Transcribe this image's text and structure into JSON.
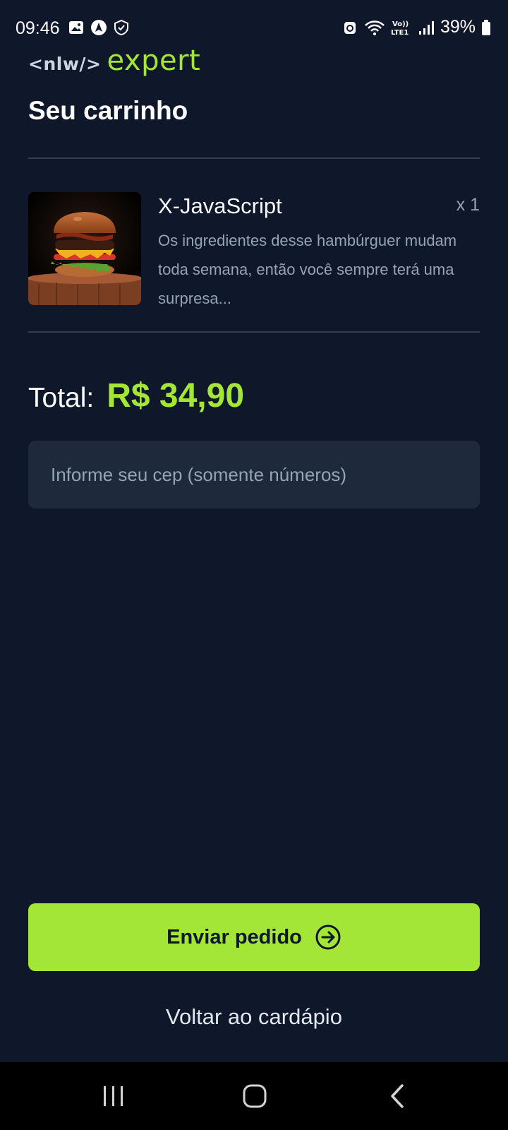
{
  "status_bar": {
    "time": "09:46",
    "battery": "39%",
    "network": "LTE1",
    "left_icons": [
      "image-icon",
      "navigation-icon",
      "shield-icon"
    ],
    "right_icons": [
      "android-icon",
      "wifi-icon",
      "signal-icon",
      "battery-icon"
    ]
  },
  "logo": {
    "prefix": "<nlw/>",
    "suffix": "expert"
  },
  "page": {
    "title": "Seu carrinho"
  },
  "cart": {
    "items": [
      {
        "name": "X-JavaScript",
        "quantity": "x 1",
        "description": "Os ingredientes desse hambúrguer mudam toda semana, então você sempre terá uma surpresa...",
        "image": "burger-image"
      }
    ],
    "total_label": "Total:",
    "total_value": "R$ 34,90"
  },
  "form": {
    "cep_placeholder": "Informe seu cep (somente números)",
    "cep_value": ""
  },
  "actions": {
    "send_label": "Enviar pedido",
    "back_label": "Voltar ao cardápio"
  },
  "colors": {
    "background": "#0f172a",
    "accent": "#a3e635",
    "input_bg": "#1e293b",
    "muted_text": "#94a3b8",
    "divider": "#334155"
  }
}
